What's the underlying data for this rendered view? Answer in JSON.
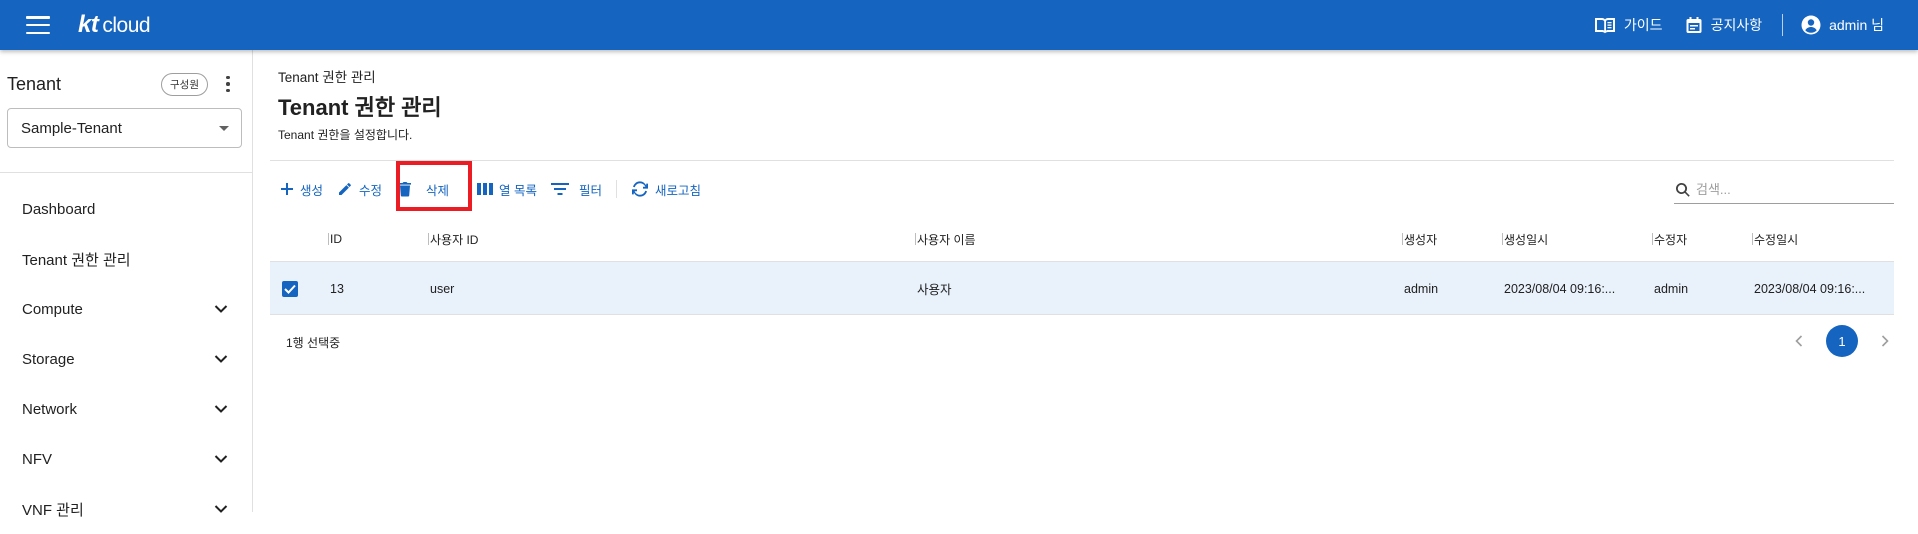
{
  "header": {
    "logo_kt": "kt",
    "logo_cloud": "cloud",
    "guide_label": "가이드",
    "notice_label": "공지사항",
    "user_label": "admin 님",
    "bar_color": "#1565c0"
  },
  "sidebar": {
    "tenant_title": "Tenant",
    "role_chip": "구성원",
    "tenant_selected": "Sample-Tenant",
    "items": [
      {
        "label": "Dashboard",
        "expandable": false
      },
      {
        "label": "Tenant 권한 관리",
        "expandable": false
      },
      {
        "label": "Compute",
        "expandable": true
      },
      {
        "label": "Storage",
        "expandable": true
      },
      {
        "label": "Network",
        "expandable": true
      },
      {
        "label": "NFV",
        "expandable": true
      },
      {
        "label": "VNF 관리",
        "expandable": true
      }
    ]
  },
  "main": {
    "breadcrumb": "Tenant 권한 관리",
    "title": "Tenant 권한 관리",
    "description": "Tenant 권한을 설정합니다.",
    "toolbar": {
      "create": "생성",
      "edit": "수정",
      "delete": "삭제",
      "columns": "열 목록",
      "filter": "필터",
      "refresh": "새로고침"
    },
    "search_placeholder": "검색...",
    "table": {
      "columns": [
        "ID",
        "사용자 ID",
        "사용자 이름",
        "생성자",
        "생성일시",
        "수정자",
        "수정일시"
      ],
      "rows": [
        {
          "checked": true,
          "id": "13",
          "user_id": "user",
          "user_name": "사용자",
          "creator": "admin",
          "created_at": "2023/08/04 09:16:...",
          "modifier": "admin",
          "modified_at": "2023/08/04 09:16:..."
        }
      ]
    },
    "selection_text": "1행 선택중",
    "pagination": {
      "current_page": "1"
    }
  },
  "accent_colors": {
    "primary": "#1565c0",
    "highlight": "#ec1c24",
    "row_selected": "#e9f1fb"
  }
}
